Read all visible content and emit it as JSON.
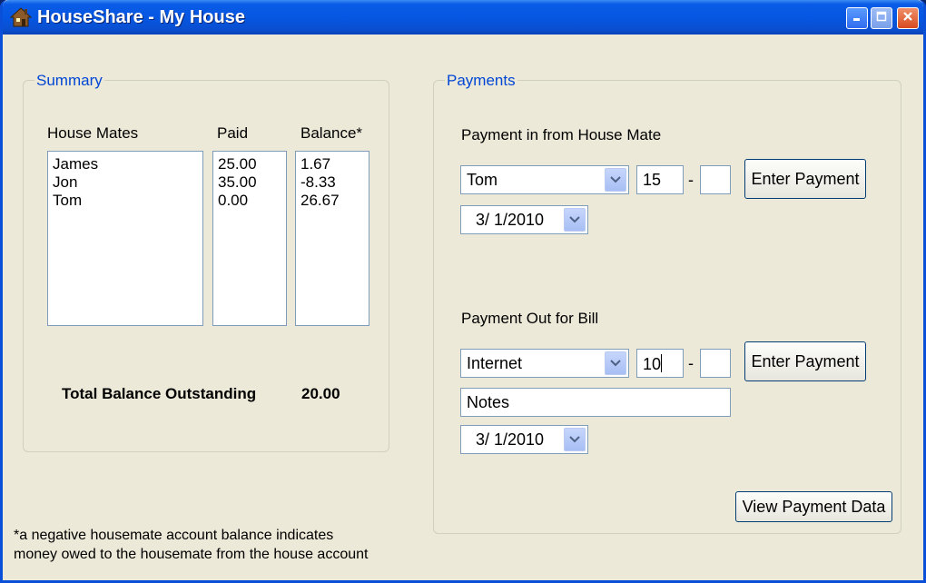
{
  "window": {
    "title": "HouseShare - My House",
    "icons": {
      "app": "house-icon",
      "minimize": "minimize-icon",
      "maximize": "maximize-icon",
      "close": "close-icon"
    }
  },
  "summary": {
    "legend": "Summary",
    "headers": {
      "house_mates": "House Mates",
      "paid": "Paid",
      "balance": "Balance*"
    },
    "house_mates": [
      "James",
      "Jon",
      "Tom"
    ],
    "paid": [
      "25.00",
      "35.00",
      "0.00"
    ],
    "balance": [
      "1.67",
      "-8.33",
      "26.67"
    ],
    "total_label": "Total Balance Outstanding",
    "total_value": "20.00"
  },
  "payments": {
    "legend": "Payments",
    "payment_in": {
      "label": "Payment in from House Mate",
      "housemate_selected": "Tom",
      "amount_whole": "15",
      "amount_cents": "",
      "date": "3/  1/2010",
      "enter_button": "Enter Payment"
    },
    "payment_out": {
      "label": "Payment Out for Bill",
      "bill_selected": "Internet",
      "amount_whole": "10",
      "amount_cents": "",
      "notes": "Notes",
      "date": "3/  1/2010",
      "enter_button": "Enter Payment"
    },
    "separator": "-",
    "view_button": "View Payment Data"
  },
  "footnote": {
    "line1": "*a negative housemate account balance indicates",
    "line2": "money owed to the housemate from the house account"
  }
}
